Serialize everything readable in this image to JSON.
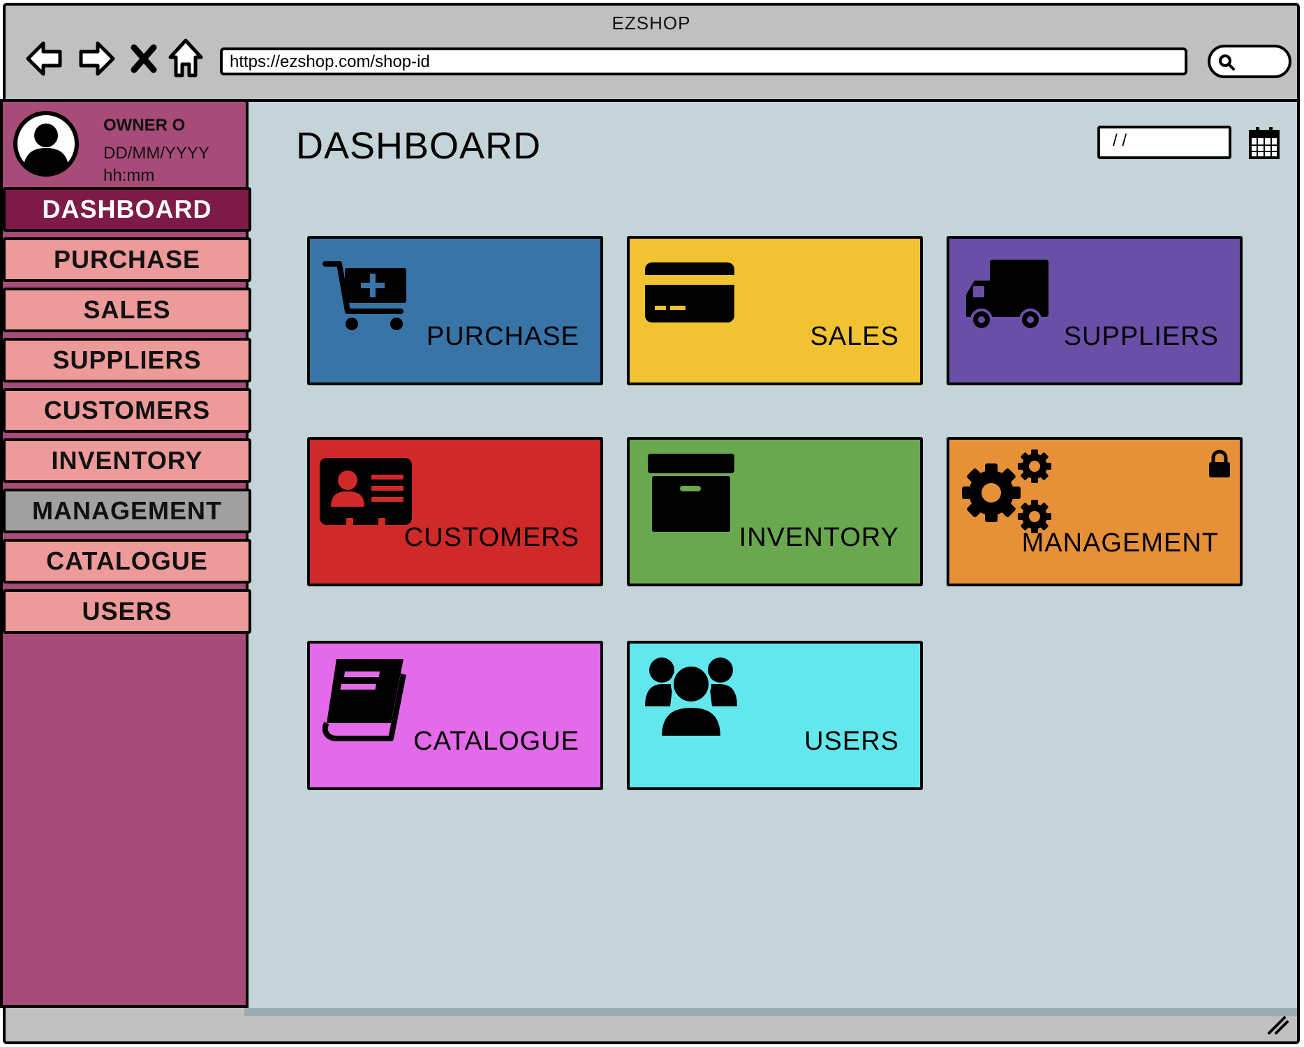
{
  "window": {
    "title": "EZSHOP"
  },
  "browser": {
    "url": "https://ezshop.com/shop-id"
  },
  "profile": {
    "name": "OWNER O",
    "date": "DD/MM/YYYY",
    "time": "hh:mm"
  },
  "sidebar": {
    "items": [
      {
        "label": "DASHBOARD",
        "state": "active"
      },
      {
        "label": "PURCHASE",
        "state": "normal"
      },
      {
        "label": "SALES",
        "state": "normal"
      },
      {
        "label": "SUPPLIERS",
        "state": "normal"
      },
      {
        "label": "CUSTOMERS",
        "state": "normal"
      },
      {
        "label": "INVENTORY",
        "state": "normal"
      },
      {
        "label": "MANAGEMENT",
        "state": "disabled"
      },
      {
        "label": "CATALOGUE",
        "state": "normal"
      },
      {
        "label": "USERS",
        "state": "normal"
      }
    ]
  },
  "main": {
    "title": "DASHBOARD",
    "date_field": " / /",
    "tiles": [
      {
        "label": "PURCHASE",
        "color": "#3874a6",
        "icon": "cart-plus-icon"
      },
      {
        "label": "SALES",
        "color": "#f1c232",
        "icon": "credit-card-icon"
      },
      {
        "label": "SUPPLIERS",
        "color": "#6a4fa7",
        "icon": "truck-icon"
      },
      {
        "label": "CUSTOMERS",
        "color": "#d0292a",
        "icon": "id-card-icon"
      },
      {
        "label": "INVENTORY",
        "color": "#6aa84f",
        "icon": "archive-box-icon"
      },
      {
        "label": "MANAGEMENT",
        "color": "#e69138",
        "icon": "gears-icon",
        "locked": true
      },
      {
        "label": "CATALOGUE",
        "color": "#e36ae8",
        "icon": "book-icon"
      },
      {
        "label": "USERS",
        "color": "#62e8ec",
        "icon": "users-icon"
      }
    ]
  },
  "colors": {
    "sidebar_bg": "#a74b78",
    "menu_item": "#ec9a9a",
    "menu_active": "#7d1a48",
    "menu_disabled": "#a0a0a0",
    "main_bg": "#c4d4d8",
    "chrome": "#c0c0c0"
  }
}
